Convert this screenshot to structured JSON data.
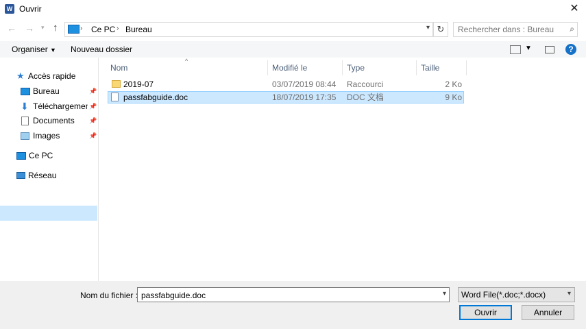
{
  "window": {
    "title": "Ouvrir",
    "app_icon_letter": "W"
  },
  "address": {
    "segments": [
      "Ce PC",
      "Bureau"
    ]
  },
  "search": {
    "placeholder": "Rechercher dans : Bureau"
  },
  "toolbar": {
    "organize": "Organiser",
    "new_folder": "Nouveau dossier"
  },
  "sidebar": {
    "items": [
      {
        "label": "Accès rapide"
      },
      {
        "label": "Bureau"
      },
      {
        "label": "Téléchargements"
      },
      {
        "label": "Documents"
      },
      {
        "label": "Images"
      },
      {
        "label": "Ce PC"
      },
      {
        "label": "Réseau"
      }
    ]
  },
  "columns": {
    "name": "Nom",
    "modified": "Modifié le",
    "type": "Type",
    "size": "Taille"
  },
  "files": [
    {
      "name": "2019-07",
      "modified": "03/07/2019 08:44",
      "type": "Raccourci",
      "size": "2 Ko"
    },
    {
      "name": "passfabguide.doc",
      "modified": "18/07/2019 17:35",
      "type": "DOC 文档",
      "size": "9 Ko"
    }
  ],
  "footer": {
    "filename_label": "Nom du fichier :",
    "filename_value": "passfabguide.doc",
    "filetype": "Word File(*.doc;*.docx)",
    "open": "Ouvrir",
    "cancel": "Annuler"
  },
  "colors": {
    "accent": "#0078d7",
    "selection": "#cce8ff"
  }
}
